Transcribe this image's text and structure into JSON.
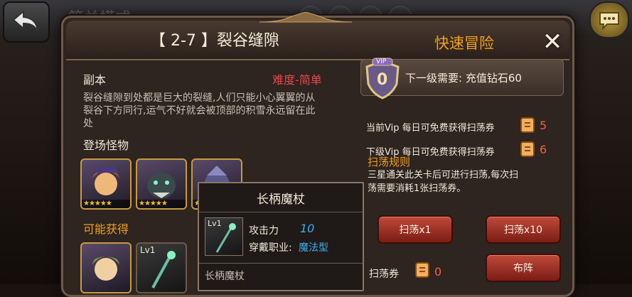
{
  "background": {
    "title": "筛关模式",
    "back_icon": "back-arrow-icon",
    "chat_icon": "chat-bubble-icon"
  },
  "dialog": {
    "stage_title": "【 2-7 】裂谷缝隙",
    "quick_adventure": "快速冒险",
    "close_icon": "close-icon"
  },
  "dungeon": {
    "section_label": "副本",
    "difficulty": "难度-简单",
    "description_lines": [
      "裂谷缝隙到处都是巨大的裂缝,人们只能小心翼翼的从",
      "裂谷下方同行,运气不好就会被顶部的积雪永远留在此",
      "处"
    ],
    "monsters_label": "登场怪物",
    "monsters": [
      {
        "stars": "★★★★★"
      },
      {
        "stars": "★★★★★"
      },
      {
        "stars": "★★★★★"
      }
    ],
    "rewards_label": "可能获得",
    "reward_items": [
      {
        "level": ""
      },
      {
        "level": "Lv1"
      }
    ]
  },
  "vip": {
    "badge_text": "VIP",
    "level": "0",
    "next_need": "下一级需要: 充值钻石60",
    "current_label": "当前Vip 每日可免费获得扫荡券",
    "current_count": "5",
    "next_label": "下级Vip 每日可免费获得扫荡券",
    "next_count": "6"
  },
  "sweep": {
    "rule_title": "扫荡规则",
    "rule_lines": [
      "三星通关此关卡后可进行扫荡,每次扫",
      "荡需要消耗1张扫荡券。"
    ],
    "button_x1": "扫荡x1",
    "button_x10": "扫荡x10",
    "ticket_label": "扫荡券",
    "ticket_count": "0",
    "formation_button": "布阵"
  },
  "tooltip": {
    "title": "长柄魔杖",
    "level": "Lv1",
    "attack_label": "攻击力",
    "attack_value": "10",
    "job_label": "穿戴职业:",
    "job_value": "魔法型",
    "item_name": "长柄魔杖"
  },
  "colors": {
    "accent_orange": "#f0a020",
    "difficulty_red": "#e84848",
    "button_red": "#c04a3a",
    "stat_blue": "#3ab0f0"
  }
}
